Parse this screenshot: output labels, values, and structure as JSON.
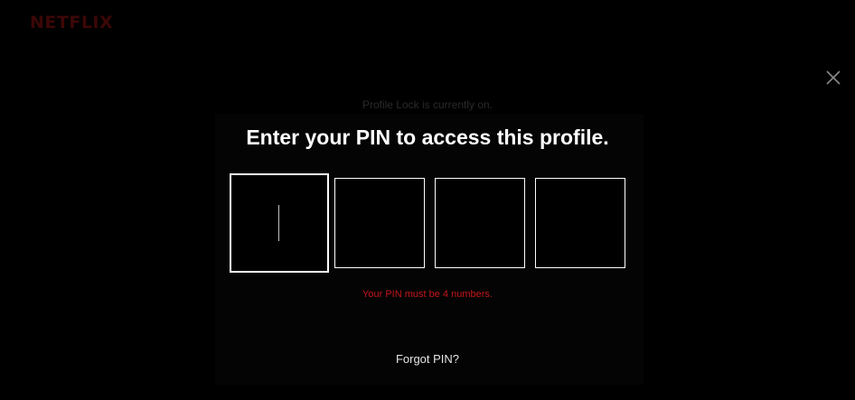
{
  "brand": {
    "logo_text": "NETFLIX",
    "logo_color": "#3d0707"
  },
  "close": {
    "icon": "close-icon"
  },
  "lock_status": "Profile Lock is currently on.",
  "title": "Enter your PIN to access this profile.",
  "pin": {
    "digits": [
      {
        "value": "",
        "active": true
      },
      {
        "value": "",
        "active": false
      },
      {
        "value": "",
        "active": false
      },
      {
        "value": "",
        "active": false
      }
    ]
  },
  "error": {
    "message": "Your PIN must be 4 numbers.",
    "color": "#c4161c"
  },
  "forgot_link": "Forgot PIN?"
}
